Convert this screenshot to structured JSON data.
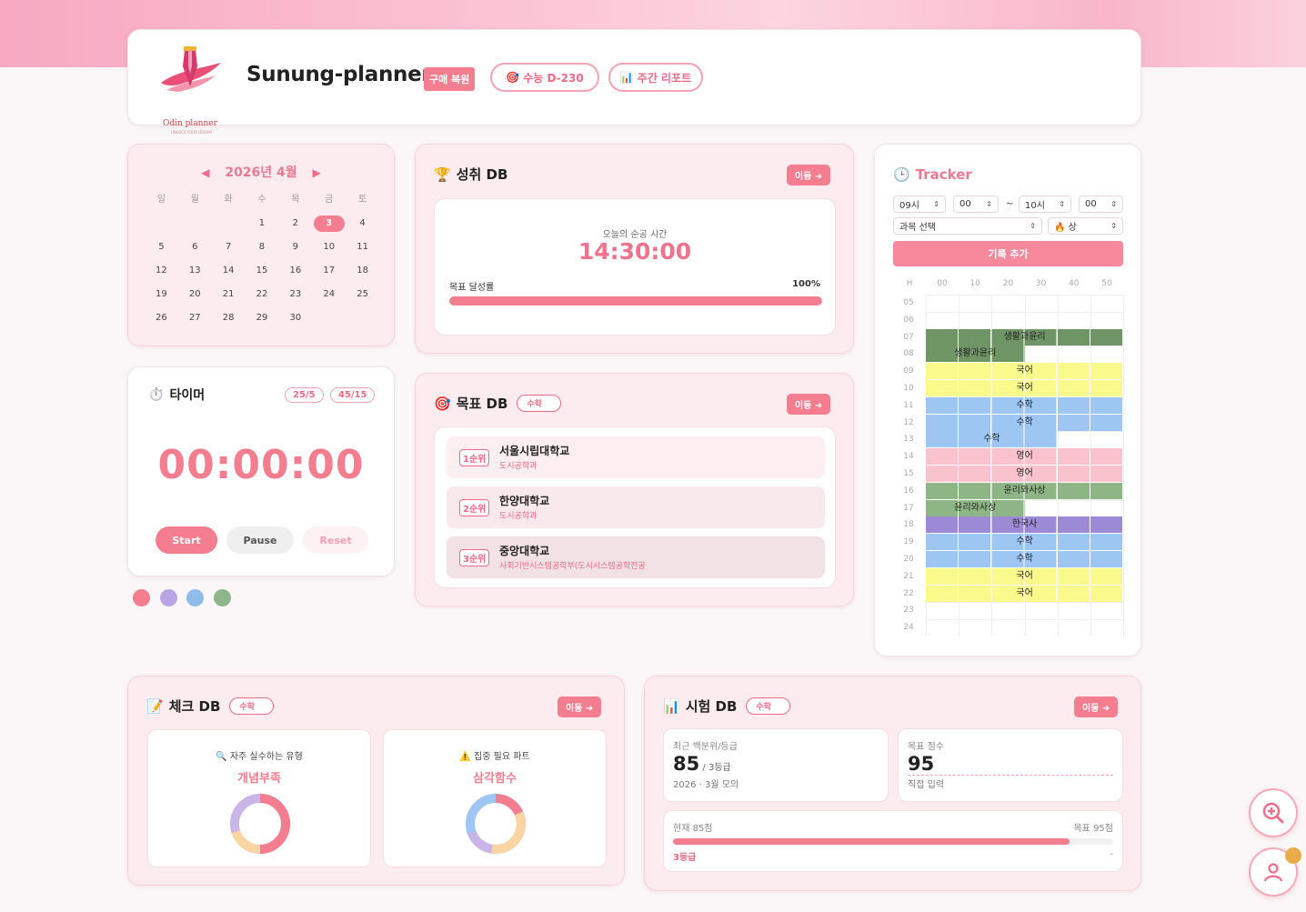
{
  "header": {
    "title": "Sunung-planner",
    "logo_text": "Odin planner",
    "logo_sub": "UNLOCK YOUR DREAM",
    "purchase_badge": "구매 복원",
    "dday_label": "수능 D-230",
    "report_label": "주간 리포트"
  },
  "calendar": {
    "month_label": "2026년 4월",
    "prev": "◀",
    "next": "▶",
    "weekdays": [
      "일",
      "월",
      "화",
      "수",
      "목",
      "금",
      "토"
    ],
    "days": [
      "",
      "",
      "",
      "1",
      "2",
      "3",
      "4",
      "5",
      "6",
      "7",
      "8",
      "9",
      "10",
      "11",
      "12",
      "13",
      "14",
      "15",
      "16",
      "17",
      "18",
      "19",
      "20",
      "21",
      "22",
      "23",
      "24",
      "25",
      "26",
      "27",
      "28",
      "29",
      "30"
    ],
    "today": "3"
  },
  "achievement": {
    "title": "성취 DB",
    "move": "이동 ➜",
    "study_label": "오늘의 순공 시간",
    "study_time": "14:30:00",
    "goal_label": "목표 달성률",
    "goal_pct_text": "100%",
    "goal_pct": 100
  },
  "tracker": {
    "title": "Tracker",
    "start_hour": "09시",
    "start_min": "00",
    "tilde": "~",
    "end_hour": "10시",
    "end_min": "00",
    "subject_placeholder": "과목 선택",
    "priority": "🔥 상",
    "add_button": "기록 추가",
    "col_header": [
      "H",
      "00",
      "10",
      "20",
      "30",
      "40",
      "50"
    ],
    "rows": [
      "05",
      "06",
      "07",
      "08",
      "09",
      "10",
      "11",
      "12",
      "13",
      "14",
      "15",
      "16",
      "17",
      "18",
      "19",
      "20",
      "21",
      "22",
      "23",
      "24"
    ],
    "blocks": [
      {
        "row": 2,
        "from": 0,
        "to": 6,
        "label": "생활과윤리",
        "color": "#6f9466"
      },
      {
        "row": 3,
        "from": 0,
        "to": 3,
        "label": "생활과윤리",
        "color": "#6f9466"
      },
      {
        "row": 4,
        "from": 0,
        "to": 6,
        "label": "국어",
        "color": "#fafa8c"
      },
      {
        "row": 5,
        "from": 0,
        "to": 6,
        "label": "국어",
        "color": "#fafa8c"
      },
      {
        "row": 6,
        "from": 0,
        "to": 6,
        "label": "수학",
        "color": "#9ec6f2"
      },
      {
        "row": 7,
        "from": 0,
        "to": 6,
        "label": "수학",
        "color": "#9ec6f2"
      },
      {
        "row": 8,
        "from": 0,
        "to": 4,
        "label": "수학",
        "color": "#9ec6f2"
      },
      {
        "row": 9,
        "from": 0,
        "to": 6,
        "label": "영어",
        "color": "#f9c2cd"
      },
      {
        "row": 10,
        "from": 0,
        "to": 6,
        "label": "영어",
        "color": "#f9c2cd"
      },
      {
        "row": 11,
        "from": 0,
        "to": 6,
        "label": "윤리와사상",
        "color": "#8eb585"
      },
      {
        "row": 12,
        "from": 0,
        "to": 3,
        "label": "윤리와사상",
        "color": "#8eb585"
      },
      {
        "row": 13,
        "from": 0,
        "to": 6,
        "label": "한국사",
        "color": "#9d8ad6"
      },
      {
        "row": 14,
        "from": 0,
        "to": 6,
        "label": "수학",
        "color": "#9ec6f2"
      },
      {
        "row": 15,
        "from": 0,
        "to": 6,
        "label": "수학",
        "color": "#9ec6f2"
      },
      {
        "row": 16,
        "from": 0,
        "to": 6,
        "label": "국어",
        "color": "#fafa8c"
      },
      {
        "row": 17,
        "from": 0,
        "to": 6,
        "label": "국어",
        "color": "#fafa8c"
      }
    ]
  },
  "timer": {
    "title": "타이머",
    "badge1": "25/5",
    "badge2": "45/15",
    "time": "00:00:00",
    "start": "Start",
    "pause": "Pause",
    "reset": "Reset"
  },
  "theme_dots": [
    "#f47d8f",
    "#b9a4e4",
    "#8fbce8",
    "#8fb58c"
  ],
  "goal_db": {
    "title": "목표 DB",
    "subject": "수학",
    "move": "이동 ➜",
    "items": [
      {
        "rank": "1순위",
        "name": "서울시립대학교",
        "dept": "도시공학과",
        "bg": "#fdeef1"
      },
      {
        "rank": "2순위",
        "name": "한양대학교",
        "dept": "도시공학과",
        "bg": "#f9e8ec"
      },
      {
        "rank": "3순위",
        "name": "중앙대학교",
        "dept": "사회기반시스템공학부(도시시스템공학전공",
        "bg": "#f2e1e5"
      }
    ]
  },
  "check_db": {
    "title": "체크 DB",
    "subject": "수학",
    "move": "이동 ➜",
    "mistake_label": "🔍 자주 실수하는 유형",
    "mistake_value": "개념부족",
    "focus_label": "⚠️ 집중 필요 파트",
    "focus_value": "삼각함수"
  },
  "exam_db": {
    "title": "시험 DB",
    "subject": "수학",
    "move": "이동 ➜",
    "recent_label": "최근 백분위/등급",
    "recent_score": "85",
    "recent_grade": " / 3등급",
    "recent_sub": "2026 · 3월 모의",
    "target_label": "목표 점수",
    "target_score": "95",
    "target_input": "직접 입력",
    "current_text": "현재 85점",
    "target_text": "목표 95점",
    "progress": 0.9,
    "grade_text": "3등급",
    "dash": "-"
  }
}
